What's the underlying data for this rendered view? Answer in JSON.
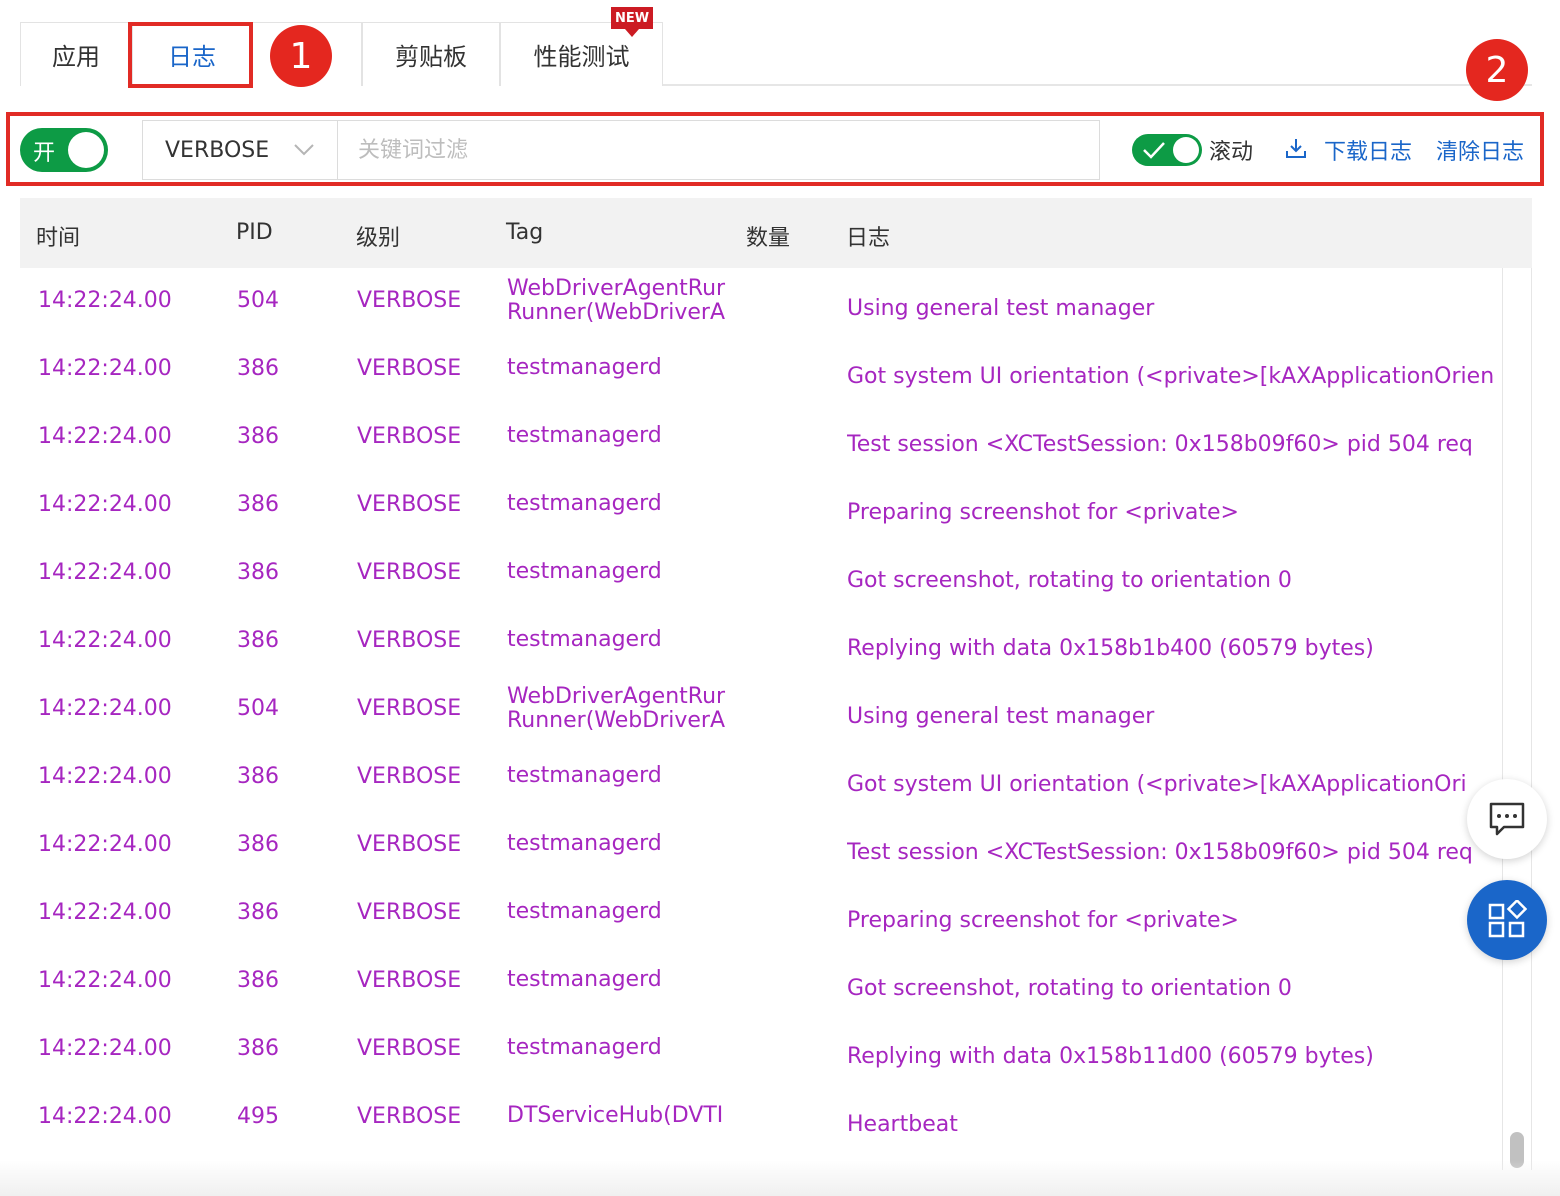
{
  "tabs": {
    "app": "应用",
    "log": "日志",
    "clipboard": "剪贴板",
    "performance": "性能测试",
    "new_badge": "NEW"
  },
  "markers": {
    "m1": "1",
    "m2": "2"
  },
  "toolbar": {
    "switch_label": "开",
    "switch_on": true,
    "level_value": "VERBOSE",
    "keyword_placeholder": "关键词过滤",
    "keyword_value": "",
    "scroll_label": "滚动",
    "scroll_on": true,
    "download_label": "下载日志",
    "clear_label": "清除日志"
  },
  "table": {
    "headers": {
      "time": "时间",
      "pid": "PID",
      "level": "级别",
      "tag": "Tag",
      "count": "数量",
      "log": "日志"
    },
    "rows": [
      {
        "time": "14:22:24.00",
        "pid": "504",
        "level": "VERBOSE",
        "tag": "WebDriverAgentRunner-Runner(WebDriverAgentRunner)",
        "tag_l1": "WebDriverAgentRur",
        "tag_l2": "Runner(WebDriverA",
        "message": "Using general test manager"
      },
      {
        "time": "14:22:24.00",
        "pid": "386",
        "level": "VERBOSE",
        "tag": "testmanagerd",
        "message": "Got system UI orientation (<private>[kAXApplicationOrien"
      },
      {
        "time": "14:22:24.00",
        "pid": "386",
        "level": "VERBOSE",
        "tag": "testmanagerd",
        "message": "Test session <XCTestSession: 0x158b09f60> pid 504 req"
      },
      {
        "time": "14:22:24.00",
        "pid": "386",
        "level": "VERBOSE",
        "tag": "testmanagerd",
        "message": "Preparing screenshot for <private>"
      },
      {
        "time": "14:22:24.00",
        "pid": "386",
        "level": "VERBOSE",
        "tag": "testmanagerd",
        "message": "Got screenshot, rotating to orientation 0"
      },
      {
        "time": "14:22:24.00",
        "pid": "386",
        "level": "VERBOSE",
        "tag": "testmanagerd",
        "message": "Replying with data 0x158b1b400 (60579 bytes)"
      },
      {
        "time": "14:22:24.00",
        "pid": "504",
        "level": "VERBOSE",
        "tag": "WebDriverAgentRunner-Runner(WebDriverAgentRunner)",
        "tag_l1": "WebDriverAgentRur",
        "tag_l2": "Runner(WebDriverA",
        "message": "Using general test manager"
      },
      {
        "time": "14:22:24.00",
        "pid": "386",
        "level": "VERBOSE",
        "tag": "testmanagerd",
        "message": "Got system UI orientation (<private>[kAXApplicationOri"
      },
      {
        "time": "14:22:24.00",
        "pid": "386",
        "level": "VERBOSE",
        "tag": "testmanagerd",
        "message": "Test session <XCTestSession: 0x158b09f60> pid 504 req"
      },
      {
        "time": "14:22:24.00",
        "pid": "386",
        "level": "VERBOSE",
        "tag": "testmanagerd",
        "message": "Preparing screenshot for <private>"
      },
      {
        "time": "14:22:24.00",
        "pid": "386",
        "level": "VERBOSE",
        "tag": "testmanagerd",
        "message": "Got screenshot, rotating to orientation 0"
      },
      {
        "time": "14:22:24.00",
        "pid": "386",
        "level": "VERBOSE",
        "tag": "testmanagerd",
        "message": "Replying with data 0x158b11d00 (60579 bytes)"
      },
      {
        "time": "14:22:24.00",
        "pid": "495",
        "level": "VERBOSE",
        "tag": "DTServiceHub(DVTI",
        "message": "Heartbeat"
      }
    ]
  },
  "icons": {
    "dropdown": "chevron-down-icon",
    "download": "download-icon",
    "check": "check-icon",
    "chat": "chat-icon",
    "apps": "apps-icon"
  },
  "colors": {
    "accent_blue": "#1a66c9",
    "switch_green": "#0d9b45",
    "log_text_magenta": "#a626c0",
    "highlight_red": "#e12b25",
    "new_badge_red": "#cc1b23"
  }
}
